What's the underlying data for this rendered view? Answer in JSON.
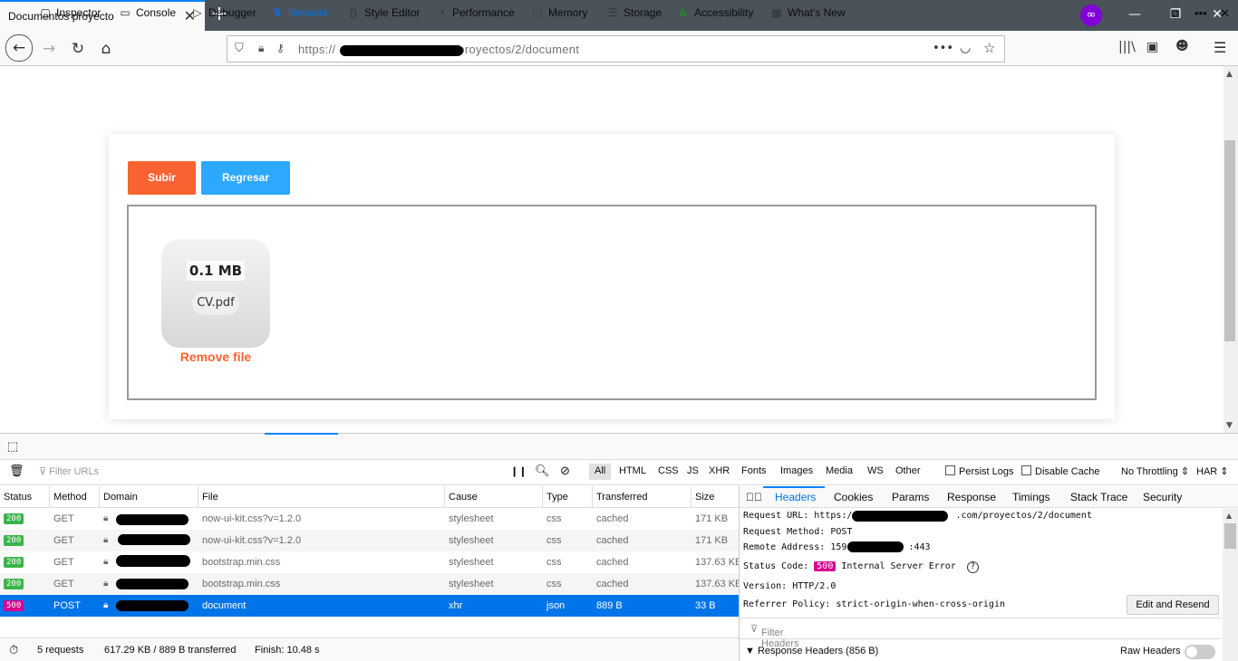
{
  "browser": {
    "tab_title": "Documentos proyecto",
    "tab_close": "✕",
    "new_tab": "+",
    "url_prefix": "https://",
    "url_path": "/proyectos/2/document",
    "page_actions": "•••"
  },
  "page": {
    "upload_button": "Subir",
    "back_button": "Regresar",
    "file_size": "0.1 MB",
    "file_name": "CV.pdf",
    "remove_file": "Remove file"
  },
  "devtools": {
    "tabs": [
      "Inspector",
      "Console",
      "Debugger",
      "Network",
      "Style Editor",
      "Performance",
      "Memory",
      "Storage",
      "Accessibility",
      "What's New"
    ],
    "selected_tab": "Network",
    "filter_placeholder": "Filter URLs",
    "type_filters": [
      "All",
      "HTML",
      "CSS",
      "JS",
      "XHR",
      "Fonts",
      "Images",
      "Media",
      "WS",
      "Other"
    ],
    "persist_logs": "Persist Logs",
    "disable_cache": "Disable Cache",
    "throttling": "No Throttling ⇕",
    "har": "HAR ⇕",
    "columns": [
      "Status",
      "Method",
      "Domain",
      "File",
      "Cause",
      "Type",
      "Transferred",
      "Size"
    ],
    "requests": [
      {
        "status": "200",
        "method": "GET",
        "file": "now-ui-kit.css?v=1.2.0",
        "cause": "stylesheet",
        "type": "css",
        "transferred": "cached",
        "size": "171 KB"
      },
      {
        "status": "200",
        "method": "GET",
        "file": "now-ui-kit.css?v=1.2.0",
        "cause": "stylesheet",
        "type": "css",
        "transferred": "cached",
        "size": "171 KB"
      },
      {
        "status": "200",
        "method": "GET",
        "file": "bootstrap.min.css",
        "cause": "stylesheet",
        "type": "css",
        "transferred": "cached",
        "size": "137.63 KB"
      },
      {
        "status": "200",
        "method": "GET",
        "file": "bootstrap.min.css",
        "cause": "stylesheet",
        "type": "css",
        "transferred": "cached",
        "size": "137.63 KB"
      },
      {
        "status": "500",
        "method": "POST",
        "file": "document",
        "cause": "xhr",
        "type": "json",
        "transferred": "889 B",
        "size": "33 B"
      }
    ],
    "summary": {
      "requests": "5 requests",
      "transferred": "617.29 KB / 889 B transferred",
      "finish": "Finish: 10.48 s"
    },
    "side_tabs": [
      "Headers",
      "Cookies",
      "Params",
      "Response",
      "Timings",
      "Stack Trace",
      "Security"
    ],
    "headers": {
      "request_url_label": "Request URL:",
      "request_url_prefix": "https://",
      "request_url_suffix": ".com/proyectos/2/document",
      "method_label": "Request Method:",
      "method_value": "POST",
      "remote_label": "Remote Address:",
      "remote_prefix": "159.",
      "remote_suffix": ":443",
      "status_label": "Status Code:",
      "status_code": "500",
      "status_text": "Internal Server Error",
      "version_label": "Version:",
      "version_value": "HTTP/2.0",
      "referrer_label": "Referrer Policy:",
      "referrer_value": "strict-origin-when-cross-origin",
      "edit_resend": "Edit and Resend",
      "filter_headers": "Filter Headers",
      "response_headers": "Response Headers (856 B)",
      "raw_headers": "Raw Headers"
    }
  },
  "colors": {
    "orange": "#f96332",
    "blue": "#2ca8ff",
    "status_ok": "#3ab54a",
    "status_error": "#d7008f",
    "selection": "#0074e8"
  }
}
